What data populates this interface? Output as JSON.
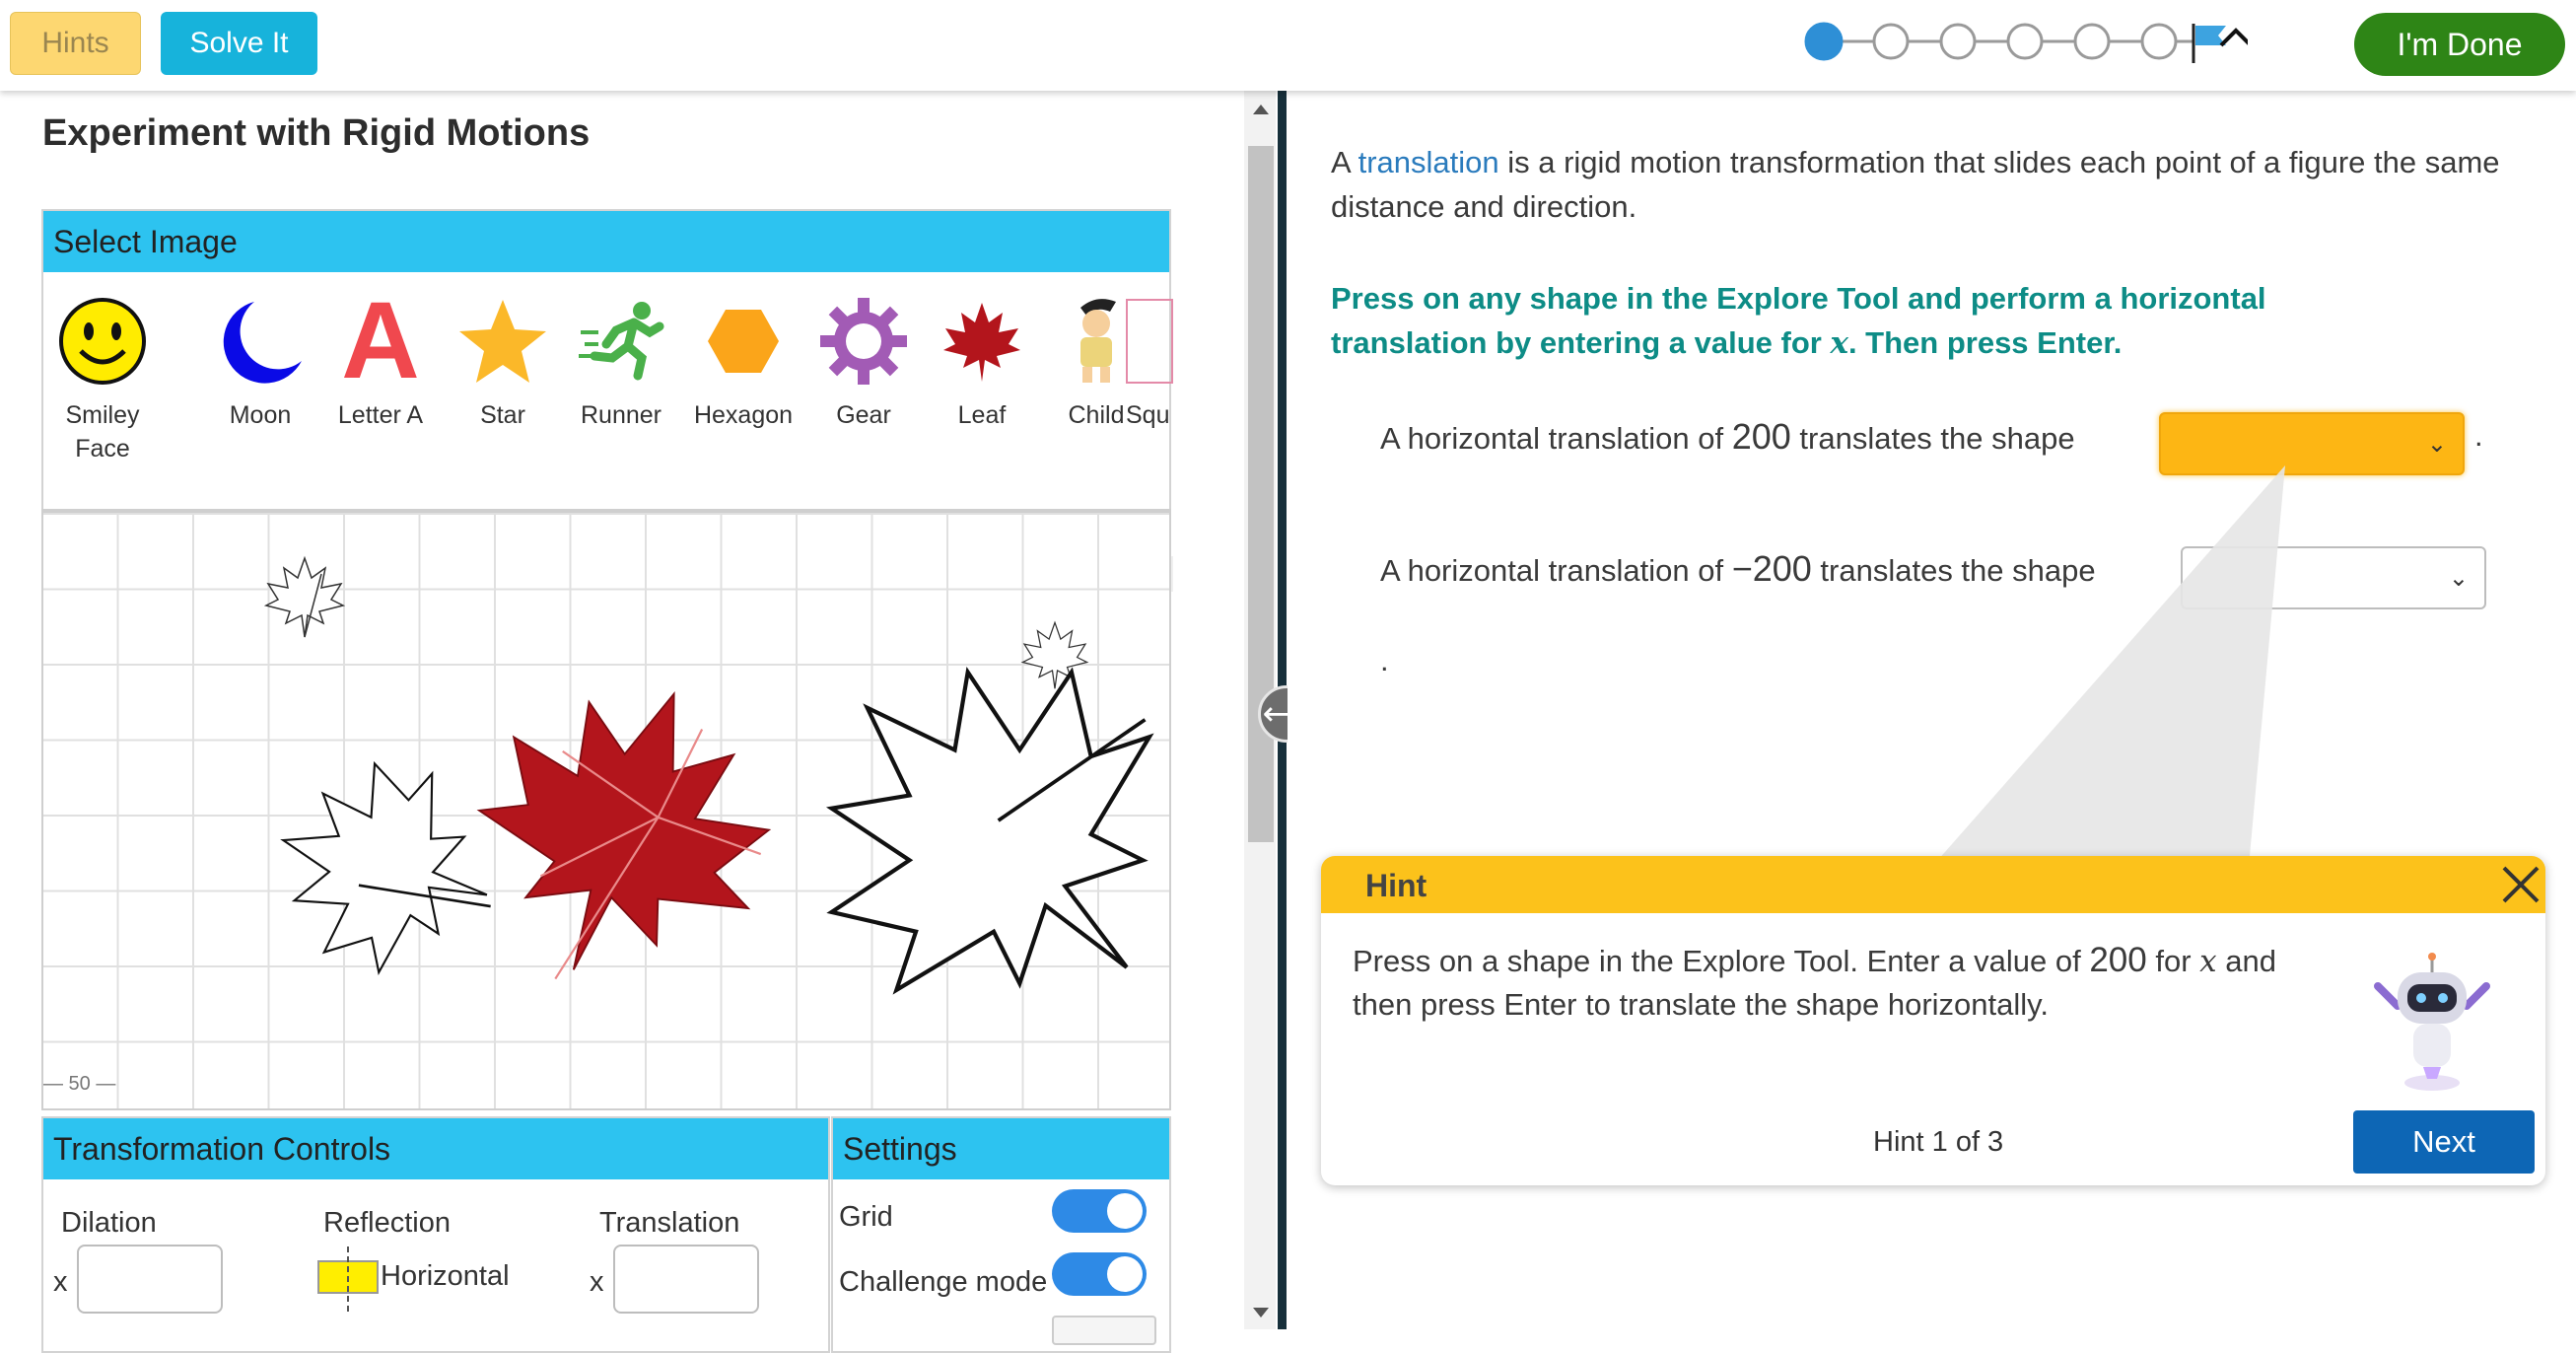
{
  "toolbar": {
    "hints_label": "Hints",
    "solve_label": "Solve It",
    "done_label": "I'm Done",
    "progress": {
      "total_steps": 6,
      "current_step": 1
    }
  },
  "left": {
    "title": "Experiment with Rigid Motions",
    "select_image": {
      "heading": "Select Image",
      "items": [
        {
          "label": "Smiley Face",
          "icon": "smiley-face-icon"
        },
        {
          "label": "Moon",
          "icon": "moon-icon"
        },
        {
          "label": "Letter A",
          "icon": "letter-a-icon"
        },
        {
          "label": "Star",
          "icon": "star-icon"
        },
        {
          "label": "Runner",
          "icon": "runner-icon"
        },
        {
          "label": "Hexagon",
          "icon": "hexagon-icon"
        },
        {
          "label": "Gear",
          "icon": "gear-icon"
        },
        {
          "label": "Leaf",
          "icon": "leaf-icon"
        },
        {
          "label": "Child",
          "icon": "child-icon"
        },
        {
          "label": "Squ",
          "icon": "square-icon"
        }
      ],
      "letter_a_glyph": "A"
    },
    "explore": {
      "axis_label": "— 50 —"
    },
    "transformation_controls": {
      "heading": "Transformation Controls",
      "dilation_label": "Dilation",
      "reflection_label": "Reflection",
      "translation_label": "Translation",
      "x_label": "x",
      "reflection_option": "Horizontal"
    },
    "settings": {
      "heading": "Settings",
      "grid_label": "Grid",
      "grid_on": true,
      "challenge_label": "Challenge mode",
      "challenge_on": true
    }
  },
  "right": {
    "intro_prefix": "A ",
    "intro_link": "translation",
    "intro_rest": " is a rigid motion transformation that slides each point of a figure the same distance and direction.",
    "instruction_part1": "Press on any shape in the Explore Tool and perform a horizontal translation by entering a value for ",
    "instruction_var": "x",
    "instruction_part2": ". Then press Enter.",
    "q1": {
      "prefix": "A horizontal translation of ",
      "value": "200",
      "suffix": " translates the shape",
      "end": "."
    },
    "q2": {
      "prefix": "A horizontal translation of ",
      "value": "−200",
      "suffix": " translates the shape",
      "end": "."
    }
  },
  "hint": {
    "title": "Hint",
    "text_part1": "Press on a shape in the Explore Tool. Enter a value of ",
    "value": "200",
    "text_part2": " for ",
    "var": "x",
    "text_part3": " and then press Enter to translate the shape horizontally.",
    "counter": "Hint 1 of 3",
    "next_label": "Next"
  },
  "colors": {
    "accent_blue": "#2dc3f0",
    "done_green": "#2e8516",
    "hint_yellow": "#fcc21b",
    "instruction_teal": "#0d8c86",
    "next_blue": "#0d66b5"
  }
}
